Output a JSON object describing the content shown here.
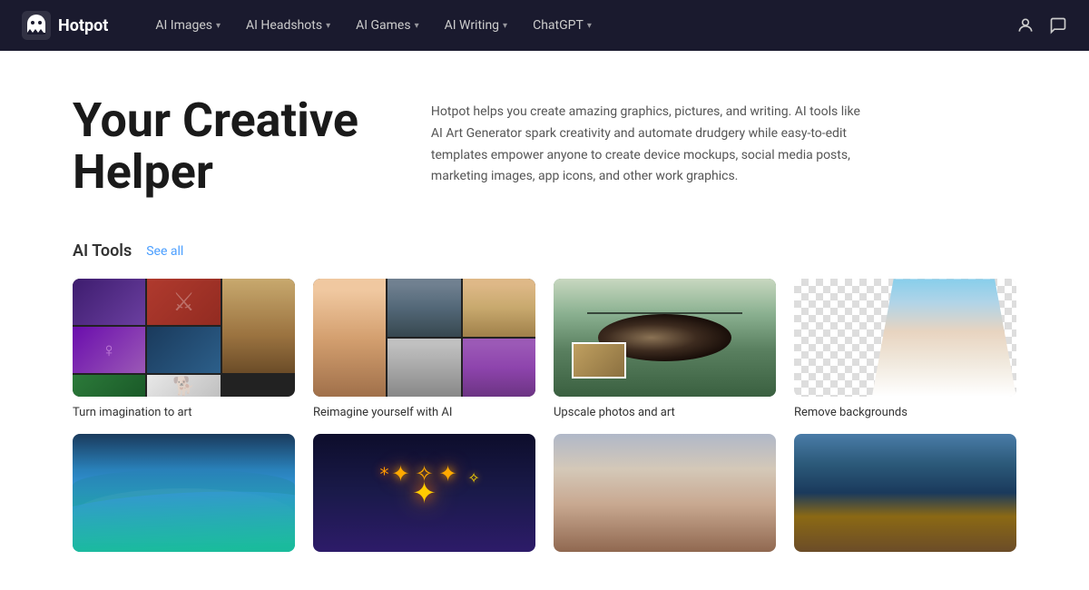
{
  "brand": {
    "name": "Hotpot",
    "logo_alt": "Hotpot logo"
  },
  "nav": {
    "links": [
      {
        "label": "AI Images",
        "has_dropdown": true
      },
      {
        "label": "AI Headshots",
        "has_dropdown": true
      },
      {
        "label": "AI Games",
        "has_dropdown": true
      },
      {
        "label": "AI Writing",
        "has_dropdown": true
      },
      {
        "label": "ChatGPT",
        "has_dropdown": true
      }
    ]
  },
  "hero": {
    "title_line1": "Your Creative",
    "title_line2": "Helper",
    "description": "Hotpot helps you create amazing graphics, pictures, and writing. AI tools like AI Art Generator spark creativity and automate drudgery while easy-to-edit templates empower anyone to create device mockups, social media posts, marketing images, app icons, and other work graphics."
  },
  "tools_section": {
    "heading": "AI Tools",
    "see_all_label": "See all",
    "cards": [
      {
        "label": "Turn imagination to art"
      },
      {
        "label": "Reimagine yourself with AI"
      },
      {
        "label": "Upscale photos and art"
      },
      {
        "label": "Remove backgrounds"
      }
    ],
    "second_row_cards": [
      {
        "label": ""
      },
      {
        "label": ""
      },
      {
        "label": ""
      },
      {
        "label": ""
      }
    ]
  }
}
